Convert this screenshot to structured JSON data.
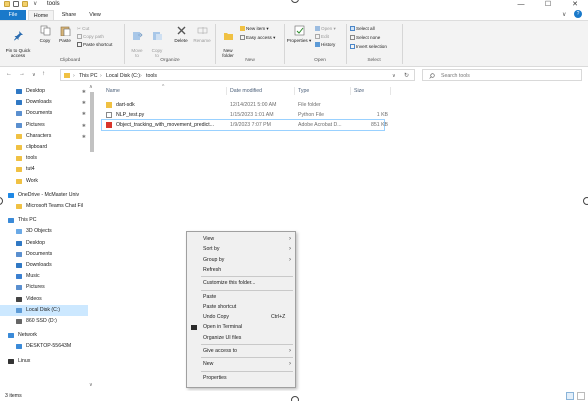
{
  "window": {
    "title": "tools",
    "minimize": "—",
    "maximize": "☐",
    "close": "✕"
  },
  "tabs": [
    {
      "label": "File"
    },
    {
      "label": "Home"
    },
    {
      "label": "Share"
    },
    {
      "label": "View"
    }
  ],
  "ribbon": {
    "pin": "Pin to Quick\naccess",
    "copy": "Copy",
    "paste": "Paste",
    "cut": "Cut",
    "copy_path": "Copy path",
    "paste_shortcut": "Paste shortcut",
    "move_to": "Move\nto",
    "copy_to": "Copy\nto",
    "delete": "Delete",
    "rename": "Rename",
    "new_folder": "New\nfolder",
    "new_item": "New item",
    "easy_access": "Easy access",
    "properties": "Properties",
    "open": "Open",
    "edit": "Edit",
    "history": "History",
    "select_all": "Select all",
    "select_none": "Select none",
    "invert_selection": "Invert selection",
    "groups": [
      "Clipboard",
      "Organize",
      "New",
      "Open",
      "Select"
    ]
  },
  "address": {
    "crumbs": [
      "This PC",
      "Local Disk (C:)",
      "tools"
    ],
    "search_placeholder": "Search tools"
  },
  "nav_items": [
    {
      "label": "Desktop",
      "icon": "desktop-icon",
      "color": "#2f78c4",
      "pinned": true
    },
    {
      "label": "Downloads",
      "icon": "downloads-icon",
      "color": "#2f78c4",
      "pinned": true
    },
    {
      "label": "Documents",
      "icon": "documents-icon",
      "color": "#5a8fcf",
      "pinned": true
    },
    {
      "label": "Pictures",
      "icon": "pictures-icon",
      "color": "#5a8fcf",
      "pinned": true
    },
    {
      "label": "Characters",
      "icon": "folder-icon",
      "color": "#f0c143",
      "pinned": true
    },
    {
      "label": "clipboard",
      "icon": "folder-icon",
      "color": "#f0c143",
      "pinned": false
    },
    {
      "label": "tools",
      "icon": "folder-icon",
      "color": "#f0c143",
      "pinned": false
    },
    {
      "label": "tut4",
      "icon": "folder-icon",
      "color": "#f0c143",
      "pinned": false
    },
    {
      "label": "Work",
      "icon": "folder-icon",
      "color": "#f0c143",
      "pinned": false
    },
    {
      "label": "OneDrive - McMaster Univ",
      "icon": "onedrive-icon",
      "color": "#1e88e5",
      "pinned": false
    },
    {
      "label": "Microsoft Teams Chat Fil",
      "icon": "folder-icon",
      "color": "#f0c143",
      "pinned": false
    },
    {
      "label": "This PC",
      "icon": "this-pc-icon",
      "color": "#3a8ad8",
      "pinned": false
    },
    {
      "label": "3D Objects",
      "icon": "3d-objects-icon",
      "color": "#6aa9e6",
      "pinned": false
    },
    {
      "label": "Desktop",
      "icon": "desktop-icon",
      "color": "#2f78c4",
      "pinned": false
    },
    {
      "label": "Documents",
      "icon": "documents-icon",
      "color": "#5a8fcf",
      "pinned": false
    },
    {
      "label": "Downloads",
      "icon": "downloads-icon",
      "color": "#2f78c4",
      "pinned": false
    },
    {
      "label": "Music",
      "icon": "music-icon",
      "color": "#3a7fd0",
      "pinned": false
    },
    {
      "label": "Pictures",
      "icon": "pictures-icon",
      "color": "#5a8fcf",
      "pinned": false
    },
    {
      "label": "Videos",
      "icon": "videos-icon",
      "color": "#444444",
      "pinned": false
    },
    {
      "label": "Local Disk (C:)",
      "icon": "drive-icon",
      "color": "#5c9ad6",
      "pinned": false,
      "selected": true
    },
    {
      "label": "860 SSD (D:)",
      "icon": "drive-icon",
      "color": "#666666",
      "pinned": false
    },
    {
      "label": "Network",
      "icon": "network-icon",
      "color": "#3a8ad8",
      "pinned": false
    },
    {
      "label": "DESKTOP-55643M",
      "icon": "computer-icon",
      "color": "#3a8ad8",
      "pinned": false
    },
    {
      "label": "Linux",
      "icon": "linux-icon",
      "color": "#333333",
      "pinned": false
    }
  ],
  "columns": [
    "Name",
    "Date modified",
    "Type",
    "Size"
  ],
  "files": [
    {
      "name": "dart-sdk",
      "date": "12/14/2021 5:00 AM",
      "type": "File folder",
      "size": "",
      "icon": "folder-icon",
      "color": "#f0c143"
    },
    {
      "name": "NLP_test.py",
      "date": "1/15/2023 1:01 AM",
      "type": "Python File",
      "size": "1 KB",
      "icon": "python-file-icon",
      "color": "#ffffff"
    },
    {
      "name": "Object_tracking_with_movement_predict...",
      "date": "1/9/2023 7:07 PM",
      "type": "Adobe Acrobat D...",
      "size": "851 KB",
      "icon": "pdf-file-icon",
      "color": "#d9352b",
      "selected": true
    }
  ],
  "context_menu": [
    {
      "label": "View",
      "arrow": true
    },
    {
      "label": "Sort by",
      "arrow": true
    },
    {
      "label": "Group by",
      "arrow": true
    },
    {
      "label": "Refresh"
    },
    {
      "sep": true
    },
    {
      "label": "Customize this folder..."
    },
    {
      "sep": true
    },
    {
      "label": "Paste"
    },
    {
      "label": "Paste shortcut"
    },
    {
      "label": "Undo Copy",
      "shortcut": "Ctrl+Z"
    },
    {
      "label": "Open in Terminal",
      "icon": true
    },
    {
      "label": "Organize UI files"
    },
    {
      "sep": true
    },
    {
      "label": "Give access to",
      "arrow": true
    },
    {
      "sep": true
    },
    {
      "label": "New",
      "arrow": true
    },
    {
      "sep": true
    },
    {
      "label": "Properties"
    }
  ],
  "status": {
    "item_count": "3 items"
  },
  "colors": {
    "accent": "#1979ca",
    "selection": "#cce8ff",
    "header_text": "#4c607a"
  }
}
